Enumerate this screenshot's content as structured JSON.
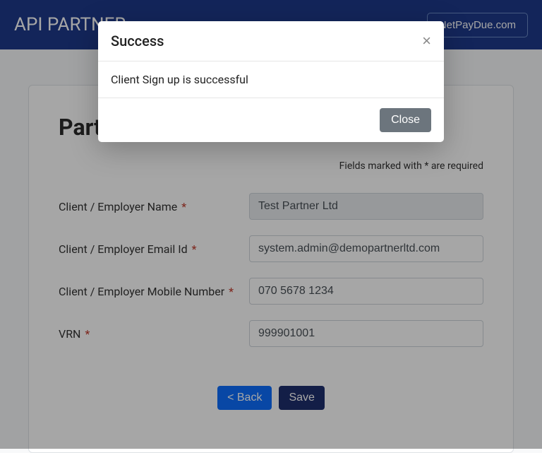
{
  "header": {
    "title": "API PARTNER",
    "button": "NetPayDue.com"
  },
  "card": {
    "title": "Partner",
    "required_note": "Fields marked with * are required"
  },
  "fields": {
    "client_name": {
      "label": "Client / Employer Name",
      "value": "Test Partner Ltd"
    },
    "client_email": {
      "label": "Client / Employer Email Id",
      "value": "system.admin@demopartnerltd.com"
    },
    "client_mobile": {
      "label": "Client / Employer Mobile Number",
      "value": "070 5678 1234"
    },
    "vrn": {
      "label": "VRN",
      "value": "999901001"
    }
  },
  "buttons": {
    "back": "<  Back",
    "save": "Save"
  },
  "modal": {
    "title": "Success",
    "message": "Client Sign up is successful",
    "close": "Close"
  }
}
